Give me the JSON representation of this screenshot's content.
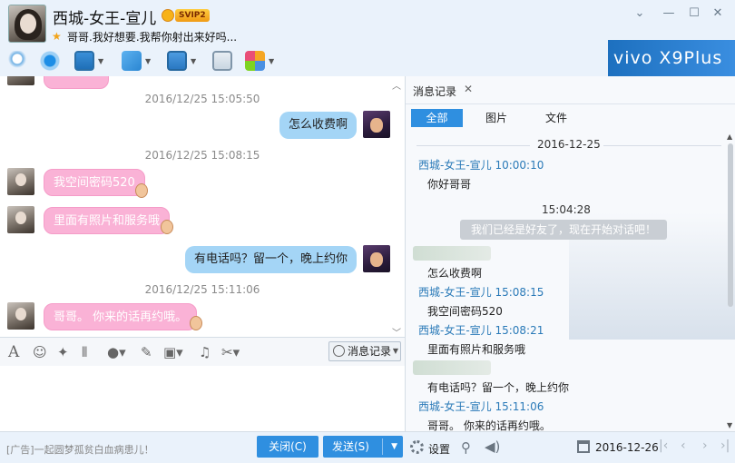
{
  "window": {
    "contact_name": "西城-女王-宣儿",
    "vip_badge": "SVIP2",
    "signature": "哥哥.我好想要.我帮你射出来好吗...",
    "ad_banner": "vivo X9Plus",
    "window_controls": [
      "chevron-down-icon",
      "minimize-icon",
      "maximize-icon",
      "close-icon"
    ]
  },
  "toolbar": {
    "icons": [
      "microphone-icon",
      "video-camera-icon",
      "screen-share-icon",
      "file-transfer-icon",
      "remote-desktop-icon",
      "add-app-icon",
      "apps-grid-icon"
    ]
  },
  "chat": {
    "messages": [
      {
        "time": "2016/12/25 15:05:50",
        "from": "me",
        "text": "怎么收费啊"
      },
      {
        "time": "2016/12/25 15:08:15",
        "from": "her",
        "text": "我空间密码520"
      },
      {
        "time": "",
        "from": "her",
        "text": "里面有照片和服务哦"
      },
      {
        "time": "",
        "from": "me",
        "text": "有电话吗？留一个，晚上约你"
      },
      {
        "time": "2016/12/25 15:11:06",
        "from": "her",
        "text": "哥哥。  你来的话再约哦。"
      }
    ]
  },
  "input_toolbar": {
    "icons": [
      "font-icon",
      "emoji-icon",
      "magic-wand-icon",
      "shake-icon",
      "voice-icon",
      "edit-icon",
      "image-icon",
      "music-icon",
      "scissors-icon"
    ],
    "msg_record_label": "消息记录"
  },
  "footer": {
    "ad_text": "[广告]一起圆梦孤贫白血病患儿！",
    "close_label": "关闭(C)",
    "send_label": "发送(S)",
    "settings_label": "设置",
    "date": "2016-12-26"
  },
  "history": {
    "tab_label": "消息记录",
    "filters": [
      "全部",
      "图片",
      "文件"
    ],
    "date": "2016-12-25",
    "entries": [
      {
        "sender": "西城-女王-宣儿 10:00:10",
        "text": "你好哥哥"
      },
      {
        "time": "15:04:28",
        "system": "我们已经是好友了，现在开始对话吧！"
      },
      {
        "text": "怎么收费啊"
      },
      {
        "sender": "西城-女王-宣儿 15:08:15",
        "text": "我空间密码520"
      },
      {
        "sender": "西城-女王-宣儿 15:08:21",
        "text": "里面有照片和服务哦"
      },
      {
        "text": "有电话吗？留一个，晚上约你"
      },
      {
        "sender": "西城-女王-宣儿 15:11:06",
        "text": "哥哥。  你来的话再约哦。"
      }
    ]
  }
}
